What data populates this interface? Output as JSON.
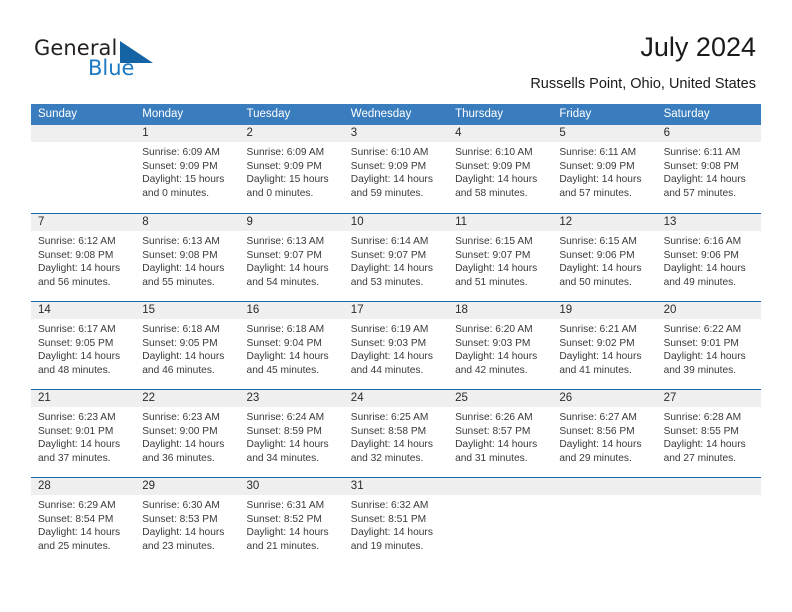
{
  "brand": {
    "name_part1": "General",
    "name_part2": "Blue",
    "triangle_color": "#1464a5",
    "blue_color": "#1b79c3"
  },
  "header": {
    "title": "July 2024",
    "location": "Russells Point, Ohio, United States"
  },
  "theme": {
    "header_blue": "#3a7dbf",
    "separator_blue": "#1a69ae",
    "day_band_gray": "#efefef"
  },
  "weekday_headers": [
    "Sunday",
    "Monday",
    "Tuesday",
    "Wednesday",
    "Thursday",
    "Friday",
    "Saturday"
  ],
  "weeks": [
    {
      "days": [
        {
          "num": "",
          "sunrise": "",
          "sunset": "",
          "daylight1": "",
          "daylight2": ""
        },
        {
          "num": "1",
          "sunrise": "Sunrise: 6:09 AM",
          "sunset": "Sunset: 9:09 PM",
          "daylight1": "Daylight: 15 hours",
          "daylight2": "and 0 minutes."
        },
        {
          "num": "2",
          "sunrise": "Sunrise: 6:09 AM",
          "sunset": "Sunset: 9:09 PM",
          "daylight1": "Daylight: 15 hours",
          "daylight2": "and 0 minutes."
        },
        {
          "num": "3",
          "sunrise": "Sunrise: 6:10 AM",
          "sunset": "Sunset: 9:09 PM",
          "daylight1": "Daylight: 14 hours",
          "daylight2": "and 59 minutes."
        },
        {
          "num": "4",
          "sunrise": "Sunrise: 6:10 AM",
          "sunset": "Sunset: 9:09 PM",
          "daylight1": "Daylight: 14 hours",
          "daylight2": "and 58 minutes."
        },
        {
          "num": "5",
          "sunrise": "Sunrise: 6:11 AM",
          "sunset": "Sunset: 9:09 PM",
          "daylight1": "Daylight: 14 hours",
          "daylight2": "and 57 minutes."
        },
        {
          "num": "6",
          "sunrise": "Sunrise: 6:11 AM",
          "sunset": "Sunset: 9:08 PM",
          "daylight1": "Daylight: 14 hours",
          "daylight2": "and 57 minutes."
        }
      ]
    },
    {
      "days": [
        {
          "num": "7",
          "sunrise": "Sunrise: 6:12 AM",
          "sunset": "Sunset: 9:08 PM",
          "daylight1": "Daylight: 14 hours",
          "daylight2": "and 56 minutes."
        },
        {
          "num": "8",
          "sunrise": "Sunrise: 6:13 AM",
          "sunset": "Sunset: 9:08 PM",
          "daylight1": "Daylight: 14 hours",
          "daylight2": "and 55 minutes."
        },
        {
          "num": "9",
          "sunrise": "Sunrise: 6:13 AM",
          "sunset": "Sunset: 9:07 PM",
          "daylight1": "Daylight: 14 hours",
          "daylight2": "and 54 minutes."
        },
        {
          "num": "10",
          "sunrise": "Sunrise: 6:14 AM",
          "sunset": "Sunset: 9:07 PM",
          "daylight1": "Daylight: 14 hours",
          "daylight2": "and 53 minutes."
        },
        {
          "num": "11",
          "sunrise": "Sunrise: 6:15 AM",
          "sunset": "Sunset: 9:07 PM",
          "daylight1": "Daylight: 14 hours",
          "daylight2": "and 51 minutes."
        },
        {
          "num": "12",
          "sunrise": "Sunrise: 6:15 AM",
          "sunset": "Sunset: 9:06 PM",
          "daylight1": "Daylight: 14 hours",
          "daylight2": "and 50 minutes."
        },
        {
          "num": "13",
          "sunrise": "Sunrise: 6:16 AM",
          "sunset": "Sunset: 9:06 PM",
          "daylight1": "Daylight: 14 hours",
          "daylight2": "and 49 minutes."
        }
      ]
    },
    {
      "days": [
        {
          "num": "14",
          "sunrise": "Sunrise: 6:17 AM",
          "sunset": "Sunset: 9:05 PM",
          "daylight1": "Daylight: 14 hours",
          "daylight2": "and 48 minutes."
        },
        {
          "num": "15",
          "sunrise": "Sunrise: 6:18 AM",
          "sunset": "Sunset: 9:05 PM",
          "daylight1": "Daylight: 14 hours",
          "daylight2": "and 46 minutes."
        },
        {
          "num": "16",
          "sunrise": "Sunrise: 6:18 AM",
          "sunset": "Sunset: 9:04 PM",
          "daylight1": "Daylight: 14 hours",
          "daylight2": "and 45 minutes."
        },
        {
          "num": "17",
          "sunrise": "Sunrise: 6:19 AM",
          "sunset": "Sunset: 9:03 PM",
          "daylight1": "Daylight: 14 hours",
          "daylight2": "and 44 minutes."
        },
        {
          "num": "18",
          "sunrise": "Sunrise: 6:20 AM",
          "sunset": "Sunset: 9:03 PM",
          "daylight1": "Daylight: 14 hours",
          "daylight2": "and 42 minutes."
        },
        {
          "num": "19",
          "sunrise": "Sunrise: 6:21 AM",
          "sunset": "Sunset: 9:02 PM",
          "daylight1": "Daylight: 14 hours",
          "daylight2": "and 41 minutes."
        },
        {
          "num": "20",
          "sunrise": "Sunrise: 6:22 AM",
          "sunset": "Sunset: 9:01 PM",
          "daylight1": "Daylight: 14 hours",
          "daylight2": "and 39 minutes."
        }
      ]
    },
    {
      "days": [
        {
          "num": "21",
          "sunrise": "Sunrise: 6:23 AM",
          "sunset": "Sunset: 9:01 PM",
          "daylight1": "Daylight: 14 hours",
          "daylight2": "and 37 minutes."
        },
        {
          "num": "22",
          "sunrise": "Sunrise: 6:23 AM",
          "sunset": "Sunset: 9:00 PM",
          "daylight1": "Daylight: 14 hours",
          "daylight2": "and 36 minutes."
        },
        {
          "num": "23",
          "sunrise": "Sunrise: 6:24 AM",
          "sunset": "Sunset: 8:59 PM",
          "daylight1": "Daylight: 14 hours",
          "daylight2": "and 34 minutes."
        },
        {
          "num": "24",
          "sunrise": "Sunrise: 6:25 AM",
          "sunset": "Sunset: 8:58 PM",
          "daylight1": "Daylight: 14 hours",
          "daylight2": "and 32 minutes."
        },
        {
          "num": "25",
          "sunrise": "Sunrise: 6:26 AM",
          "sunset": "Sunset: 8:57 PM",
          "daylight1": "Daylight: 14 hours",
          "daylight2": "and 31 minutes."
        },
        {
          "num": "26",
          "sunrise": "Sunrise: 6:27 AM",
          "sunset": "Sunset: 8:56 PM",
          "daylight1": "Daylight: 14 hours",
          "daylight2": "and 29 minutes."
        },
        {
          "num": "27",
          "sunrise": "Sunrise: 6:28 AM",
          "sunset": "Sunset: 8:55 PM",
          "daylight1": "Daylight: 14 hours",
          "daylight2": "and 27 minutes."
        }
      ]
    },
    {
      "days": [
        {
          "num": "28",
          "sunrise": "Sunrise: 6:29 AM",
          "sunset": "Sunset: 8:54 PM",
          "daylight1": "Daylight: 14 hours",
          "daylight2": "and 25 minutes."
        },
        {
          "num": "29",
          "sunrise": "Sunrise: 6:30 AM",
          "sunset": "Sunset: 8:53 PM",
          "daylight1": "Daylight: 14 hours",
          "daylight2": "and 23 minutes."
        },
        {
          "num": "30",
          "sunrise": "Sunrise: 6:31 AM",
          "sunset": "Sunset: 8:52 PM",
          "daylight1": "Daylight: 14 hours",
          "daylight2": "and 21 minutes."
        },
        {
          "num": "31",
          "sunrise": "Sunrise: 6:32 AM",
          "sunset": "Sunset: 8:51 PM",
          "daylight1": "Daylight: 14 hours",
          "daylight2": "and 19 minutes."
        },
        {
          "num": "",
          "sunrise": "",
          "sunset": "",
          "daylight1": "",
          "daylight2": ""
        },
        {
          "num": "",
          "sunrise": "",
          "sunset": "",
          "daylight1": "",
          "daylight2": ""
        },
        {
          "num": "",
          "sunrise": "",
          "sunset": "",
          "daylight1": "",
          "daylight2": ""
        }
      ]
    }
  ]
}
